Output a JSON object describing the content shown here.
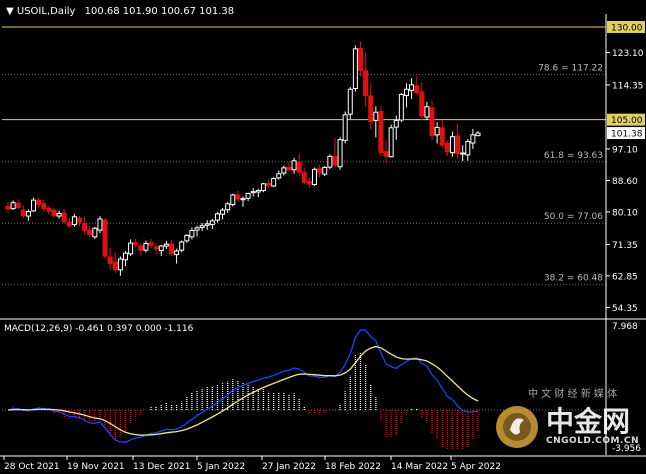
{
  "header": {
    "symbol": "USOIL,Daily",
    "ohlc": "100.68 101.90 100.67 101.38"
  },
  "macd": {
    "label": "MACD(12,26,9) -0.461 0.397 0.000 -1.116",
    "axis": [
      "7.968",
      "-3.956"
    ]
  },
  "price_axis": [
    "123.10",
    "114.35",
    "97.10",
    "88.60",
    "80.10",
    "71.35",
    "62.85",
    "54.35"
  ],
  "horizontal_lines": [
    {
      "value": 130.0,
      "label": "130.00",
      "color": "#e0d060"
    },
    {
      "value": 105.0,
      "label": "105.00",
      "color": "#e0d060"
    }
  ],
  "fib_levels": [
    {
      "value": 117.22,
      "label": "78.6 = 117.22"
    },
    {
      "value": 93.63,
      "label": "61.8 = 93.63"
    },
    {
      "value": 77.06,
      "label": "50.0 = 77.06"
    },
    {
      "value": 60.48,
      "label": "38.2 = 60.48"
    }
  ],
  "current_price": "101.38",
  "time_axis": [
    "28 Oct 2021",
    "19 Nov 2021",
    "13 Dec 2021",
    "5 Jan 2022",
    "27 Jan 2022",
    "18 Feb 2022",
    "14 Mar 2022",
    "5 Apr 2022"
  ],
  "watermark": {
    "brand": "中金网",
    "sub": "中 文 财 经 新 媒 体",
    "domain": "CNGOLD.COM.CN"
  },
  "colors": {
    "background": "#000000",
    "bull": "#ffffff",
    "bear": "#e01010",
    "grid": "#707070",
    "signal": "#f0e68c",
    "macd_line": "#2040ff",
    "hist_pos": "#ffffff",
    "hist_neg": "#e01010"
  },
  "chart_data": {
    "type": "candlestick",
    "symbol": "USOIL",
    "timeframe": "Daily",
    "ohlc": [
      [
        81.6,
        82.7,
        79.8,
        80.9
      ],
      [
        81.0,
        83.2,
        80.6,
        82.6
      ],
      [
        82.5,
        83.5,
        80.9,
        81.3
      ],
      [
        80.6,
        81.9,
        78.4,
        79.1
      ],
      [
        79.0,
        80.8,
        77.7,
        80.2
      ],
      [
        80.4,
        84.0,
        80.1,
        83.3
      ],
      [
        83.2,
        84.0,
        81.2,
        82.1
      ],
      [
        82.4,
        83.4,
        80.2,
        81.0
      ],
      [
        81.1,
        81.8,
        79.4,
        80.3
      ],
      [
        80.6,
        81.2,
        78.6,
        79.1
      ],
      [
        79.0,
        80.5,
        78.3,
        79.7
      ],
      [
        79.8,
        80.8,
        77.0,
        77.5
      ],
      [
        77.3,
        78.5,
        75.8,
        76.3
      ],
      [
        76.7,
        79.6,
        76.1,
        78.8
      ],
      [
        78.4,
        79.0,
        76.3,
        77.4
      ],
      [
        77.0,
        78.8,
        74.0,
        75.1
      ],
      [
        75.2,
        76.4,
        73.2,
        74.0
      ],
      [
        73.4,
        76.1,
        72.8,
        75.7
      ],
      [
        75.2,
        79.0,
        74.4,
        78.2
      ],
      [
        77.9,
        78.5,
        67.4,
        68.2
      ],
      [
        68.0,
        70.5,
        64.4,
        66.2
      ],
      [
        66.6,
        69.2,
        63.7,
        64.6
      ],
      [
        64.5,
        68.1,
        62.9,
        67.4
      ],
      [
        67.2,
        69.6,
        65.5,
        69.0
      ],
      [
        68.8,
        72.7,
        68.2,
        71.7
      ],
      [
        71.8,
        72.8,
        70.3,
        71.3
      ],
      [
        71.0,
        71.7,
        68.3,
        69.7
      ],
      [
        69.8,
        72.4,
        69.2,
        71.6
      ],
      [
        71.8,
        72.8,
        70.3,
        71.1
      ],
      [
        70.7,
        71.6,
        68.7,
        70.2
      ],
      [
        69.7,
        71.2,
        68.2,
        70.9
      ],
      [
        70.9,
        72.3,
        70.1,
        71.4
      ],
      [
        71.5,
        72.5,
        68.2,
        68.9
      ],
      [
        68.6,
        70.2,
        66.2,
        69.6
      ],
      [
        69.8,
        72.4,
        69.2,
        72.0
      ],
      [
        72.3,
        74.1,
        71.8,
        73.8
      ],
      [
        73.4,
        75.9,
        72.7,
        75.1
      ],
      [
        75.2,
        76.4,
        73.5,
        75.8
      ],
      [
        75.9,
        77.1,
        75.0,
        76.4
      ],
      [
        76.5,
        77.9,
        75.3,
        76.9
      ],
      [
        76.7,
        78.2,
        75.5,
        77.7
      ],
      [
        77.9,
        80.1,
        77.2,
        79.6
      ],
      [
        79.5,
        81.2,
        78.1,
        80.6
      ],
      [
        80.7,
        82.8,
        79.9,
        82.3
      ],
      [
        82.1,
        85.0,
        81.6,
        84.7
      ],
      [
        84.7,
        85.8,
        82.9,
        83.6
      ],
      [
        83.4,
        84.3,
        81.5,
        83.7
      ],
      [
        83.8,
        85.3,
        83.0,
        85.1
      ],
      [
        85.3,
        86.5,
        84.3,
        85.6
      ],
      [
        85.5,
        86.4,
        84.1,
        85.9
      ],
      [
        85.9,
        88.0,
        85.4,
        87.7
      ],
      [
        87.8,
        88.9,
        86.6,
        87.2
      ],
      [
        87.1,
        89.5,
        86.8,
        89.1
      ],
      [
        89.3,
        91.3,
        88.8,
        90.4
      ],
      [
        90.6,
        92.6,
        89.9,
        92.0
      ],
      [
        92.1,
        93.8,
        91.2,
        91.4
      ],
      [
        91.5,
        94.7,
        90.4,
        93.9
      ],
      [
        93.6,
        95.8,
        90.0,
        90.8
      ],
      [
        90.7,
        91.9,
        87.6,
        88.1
      ],
      [
        88.3,
        89.4,
        86.6,
        87.6
      ],
      [
        87.5,
        92.1,
        87.1,
        91.6
      ],
      [
        91.8,
        92.7,
        89.4,
        90.6
      ],
      [
        90.3,
        92.5,
        89.8,
        92.1
      ],
      [
        92.2,
        95.6,
        91.7,
        95.1
      ],
      [
        95.0,
        100.1,
        92.2,
        92.8
      ],
      [
        92.3,
        100.3,
        91.5,
        99.6
      ],
      [
        99.4,
        107.2,
        98.6,
        106.3
      ],
      [
        106.5,
        113.8,
        105.2,
        113.2
      ],
      [
        113.4,
        125.0,
        112.6,
        124.1
      ],
      [
        124.2,
        126.0,
        116.7,
        118.3
      ],
      [
        118.2,
        123.1,
        108.5,
        111.5
      ],
      [
        111.4,
        114.7,
        102.3,
        104.5
      ],
      [
        104.8,
        108.6,
        100.2,
        107.0
      ],
      [
        107.2,
        108.8,
        95.2,
        96.1
      ],
      [
        96.4,
        99.4,
        93.2,
        95.1
      ],
      [
        95.0,
        103.7,
        94.8,
        102.8
      ],
      [
        103.0,
        106.1,
        99.6,
        104.8
      ],
      [
        104.9,
        112.2,
        104.4,
        111.8
      ],
      [
        111.5,
        114.8,
        108.3,
        113.2
      ],
      [
        112.9,
        116.2,
        110.6,
        114.4
      ],
      [
        114.1,
        116.7,
        111.6,
        112.3
      ],
      [
        112.5,
        115.0,
        104.9,
        106.0
      ],
      [
        105.7,
        109.8,
        104.9,
        108.5
      ],
      [
        108.2,
        110.1,
        99.4,
        100.7
      ],
      [
        100.9,
        104.3,
        98.6,
        102.9
      ],
      [
        102.8,
        105.0,
        97.3,
        98.1
      ],
      [
        98.6,
        99.4,
        95.2,
        96.4
      ],
      [
        96.1,
        101.8,
        95.0,
        100.4
      ],
      [
        100.6,
        103.9,
        94.5,
        95.8
      ],
      [
        95.9,
        98.1,
        93.8,
        96.0
      ],
      [
        95.5,
        99.8,
        93.9,
        99.1
      ],
      [
        98.7,
        102.5,
        97.1,
        100.9
      ],
      [
        100.68,
        101.9,
        100.67,
        101.38
      ]
    ],
    "macd": {
      "params": "12,26,9",
      "values": {
        "main": -0.461,
        "signal": 0.397,
        "level": 0.0,
        "histogram": -1.116
      }
    }
  }
}
